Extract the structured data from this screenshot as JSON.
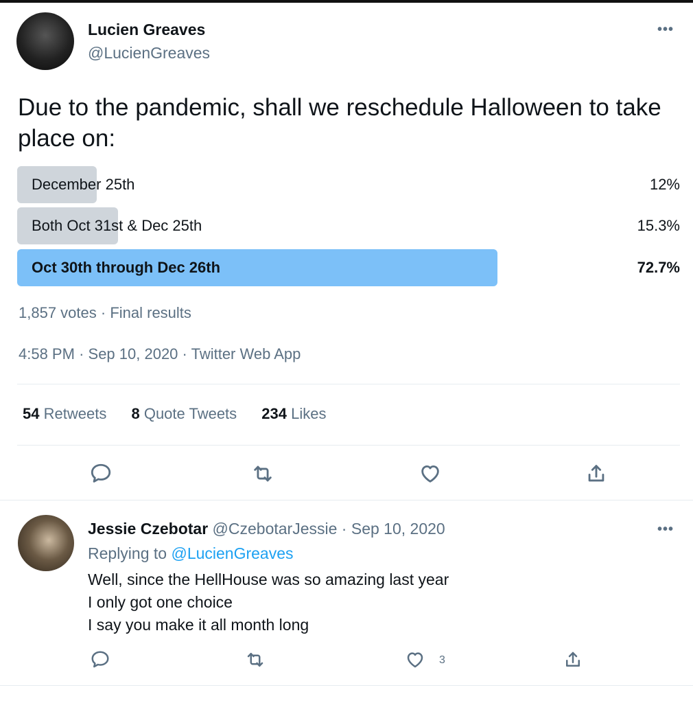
{
  "tweet": {
    "author_name": "Lucien Greaves",
    "author_handle": "@LucienGreaves",
    "text": "Due to the pandemic, shall we reschedule Halloween to take place on:",
    "poll": {
      "options": [
        {
          "label": "December 25th",
          "percent": "12%",
          "share": 0.12,
          "winner": false
        },
        {
          "label": "Both Oct 31st & Dec 25th",
          "percent": "15.3%",
          "share": 0.153,
          "winner": false
        },
        {
          "label": "Oct 30th through Dec 26th",
          "percent": "72.7%",
          "share": 0.727,
          "winner": true
        }
      ],
      "votes": "1,857 votes",
      "status": "Final results"
    },
    "time": "4:58 PM",
    "date": "Sep 10, 2020",
    "source": "Twitter Web App",
    "stats": {
      "retweets_count": "54",
      "retweets_label": "Retweets",
      "quotes_count": "8",
      "quotes_label": "Quote Tweets",
      "likes_count": "234",
      "likes_label": "Likes"
    },
    "more_label": "•••"
  },
  "reply": {
    "author_name": "Jessie Czebotar",
    "author_handle": "@CzebotarJessie",
    "date": "Sep 10, 2020",
    "replying_to_label": "Replying to",
    "replying_to_handle": "@LucienGreaves",
    "lines": [
      "Well, since the HellHouse was so amazing last year",
      "I only got one choice",
      "I say you make it all month long"
    ],
    "like_count": "3",
    "more_label": "•••"
  },
  "colors": {
    "winner_bar": "#7cc0f8",
    "loser_bar": "#cfd5db",
    "muted_text": "#5b7083",
    "link": "#1da1f2"
  },
  "icons": [
    "reply-icon",
    "retweet-icon",
    "like-icon",
    "share-icon",
    "more-icon"
  ]
}
